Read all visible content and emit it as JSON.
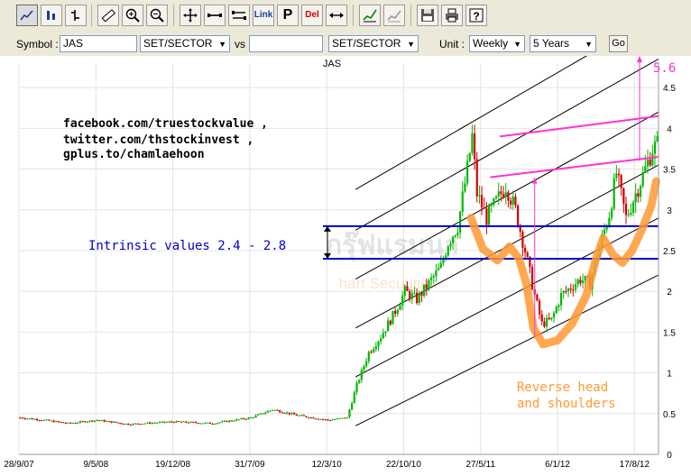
{
  "toolbar": {
    "link_label": "Link",
    "p_label": "P",
    "del_label": "Del"
  },
  "form": {
    "symbol_label": "Symbol :",
    "symbol_value": "JAS",
    "market_select": "SET/SECTOR",
    "vs_label": "vs",
    "vs_value": "",
    "vs_market_select": "SET/SECTOR",
    "unit_label": "Unit :",
    "unit_select": "Weekly",
    "period_select": "5 Years",
    "go_label": "Go"
  },
  "chart_data": {
    "type": "candlestick",
    "title": "JAS",
    "ylim": [
      0,
      4.8
    ],
    "y_ticks": [
      "0",
      "0.5",
      "1",
      "1.5",
      "2",
      "2.5",
      "3",
      "3.5",
      "4",
      "4.5"
    ],
    "x_ticks": [
      "28/9/07",
      "9/5/08",
      "19/12/08",
      "31/7/09",
      "12/3/10",
      "22/10/10",
      "27/5/11",
      "6/1/12",
      "17/8/12"
    ],
    "x_tick_weeks": [
      0,
      32,
      64,
      96,
      128,
      160,
      192,
      224,
      256
    ],
    "weeks_total": 266,
    "price_path": [
      [
        0,
        0.45
      ],
      [
        10,
        0.42
      ],
      [
        20,
        0.38
      ],
      [
        32,
        0.42
      ],
      [
        45,
        0.37
      ],
      [
        64,
        0.4
      ],
      [
        80,
        0.38
      ],
      [
        96,
        0.45
      ],
      [
        105,
        0.55
      ],
      [
        115,
        0.48
      ],
      [
        128,
        0.42
      ],
      [
        136,
        0.45
      ],
      [
        140,
        0.85
      ],
      [
        145,
        1.25
      ],
      [
        150,
        1.45
      ],
      [
        155,
        1.7
      ],
      [
        160,
        2.0
      ],
      [
        165,
        1.9
      ],
      [
        170,
        2.1
      ],
      [
        175,
        2.3
      ],
      [
        178,
        2.6
      ],
      [
        182,
        2.8
      ],
      [
        186,
        3.5
      ],
      [
        188,
        3.9
      ],
      [
        190,
        3.2
      ],
      [
        194,
        2.9
      ],
      [
        198,
        3.1
      ],
      [
        202,
        3.3
      ],
      [
        206,
        3.0
      ],
      [
        210,
        2.5
      ],
      [
        214,
        1.95
      ],
      [
        217,
        1.6
      ],
      [
        221,
        1.65
      ],
      [
        225,
        1.95
      ],
      [
        229,
        2.05
      ],
      [
        233,
        2.15
      ],
      [
        237,
        2.1
      ],
      [
        241,
        2.55
      ],
      [
        245,
        2.95
      ],
      [
        248,
        3.45
      ],
      [
        252,
        2.9
      ],
      [
        256,
        3.2
      ],
      [
        260,
        3.5
      ],
      [
        263,
        3.75
      ],
      [
        265,
        3.8
      ]
    ],
    "annotations": {
      "social": [
        "facebook.com/truestockvalue ,",
        "twitter.com/thstockinvest ,",
        "gplus.to/chamlaehoon"
      ],
      "intrinsic": "Intrinsic values 2.4 - 2.8",
      "pattern": [
        "Reverse head",
        "and shoulders"
      ],
      "target": "5.6"
    },
    "levels": {
      "intrinsic": [
        2.4,
        2.8
      ]
    },
    "lines": {
      "resistance_upper": [
        [
          200,
          3.9
        ],
        [
          266,
          4.15
        ]
      ],
      "resistance_lower": [
        [
          196,
          3.4
        ],
        [
          266,
          3.65
        ]
      ],
      "channel_lines": [
        [
          [
            140,
            0.35
          ],
          [
            266,
            2.2
          ]
        ],
        [
          [
            140,
            0.95
          ],
          [
            266,
            2.9
          ]
        ],
        [
          [
            140,
            1.55
          ],
          [
            266,
            3.55
          ]
        ],
        [
          [
            140,
            2.15
          ],
          [
            266,
            4.2
          ]
        ],
        [
          [
            140,
            2.75
          ],
          [
            266,
            4.85
          ]
        ],
        [
          [
            140,
            3.25
          ],
          [
            266,
            5.4
          ]
        ]
      ]
    },
    "colors": {
      "up": "#00b800",
      "down": "#d40000",
      "grid": "#e4e4e4",
      "channel": "#000000",
      "resistance": "#ff33cc",
      "intrinsic": "#0000cc",
      "pattern": "#ff9933",
      "annotation_text": "#000000",
      "watermark": "#c8c8c8"
    }
  }
}
